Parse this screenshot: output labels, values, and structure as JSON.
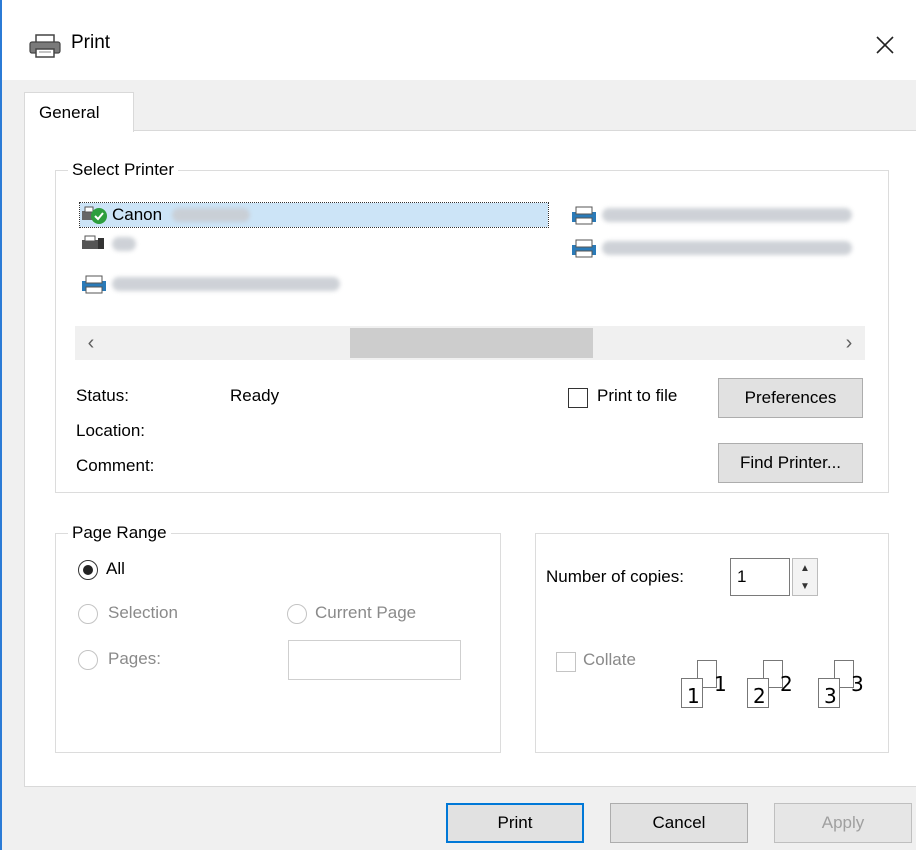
{
  "window": {
    "title": "Print",
    "close_glyph": "✕"
  },
  "tabs": [
    {
      "label": "General"
    }
  ],
  "select_printer": {
    "title": "Select Printer",
    "printers": [
      {
        "name": "Canon",
        "selected": true,
        "default": true
      },
      {
        "name": "",
        "selected": false
      },
      {
        "name": "",
        "selected": false
      },
      {
        "name": "",
        "selected": false
      },
      {
        "name": "",
        "selected": false
      }
    ],
    "scroll_left": "‹",
    "scroll_right": "›",
    "status_label": "Status:",
    "status_value": "Ready",
    "location_label": "Location:",
    "comment_label": "Comment:",
    "print_to_file_label": "Print to file",
    "preferences_label": "Preferences",
    "find_printer_label": "Find Printer..."
  },
  "page_range": {
    "title": "Page Range",
    "all_label": "All",
    "selection_label": "Selection",
    "current_page_label": "Current Page",
    "pages_label": "Pages:",
    "selected": "All"
  },
  "copies": {
    "number_label": "Number of copies:",
    "value": "1",
    "collate_label": "Collate",
    "collate_pages": [
      "1",
      "1",
      "2",
      "2",
      "3",
      "3"
    ]
  },
  "footer": {
    "print_label": "Print",
    "cancel_label": "Cancel",
    "apply_label": "Apply"
  },
  "colors": {
    "accent": "#0078d7",
    "selection": "#cce4f7",
    "window_border": "#2b7bd6"
  }
}
